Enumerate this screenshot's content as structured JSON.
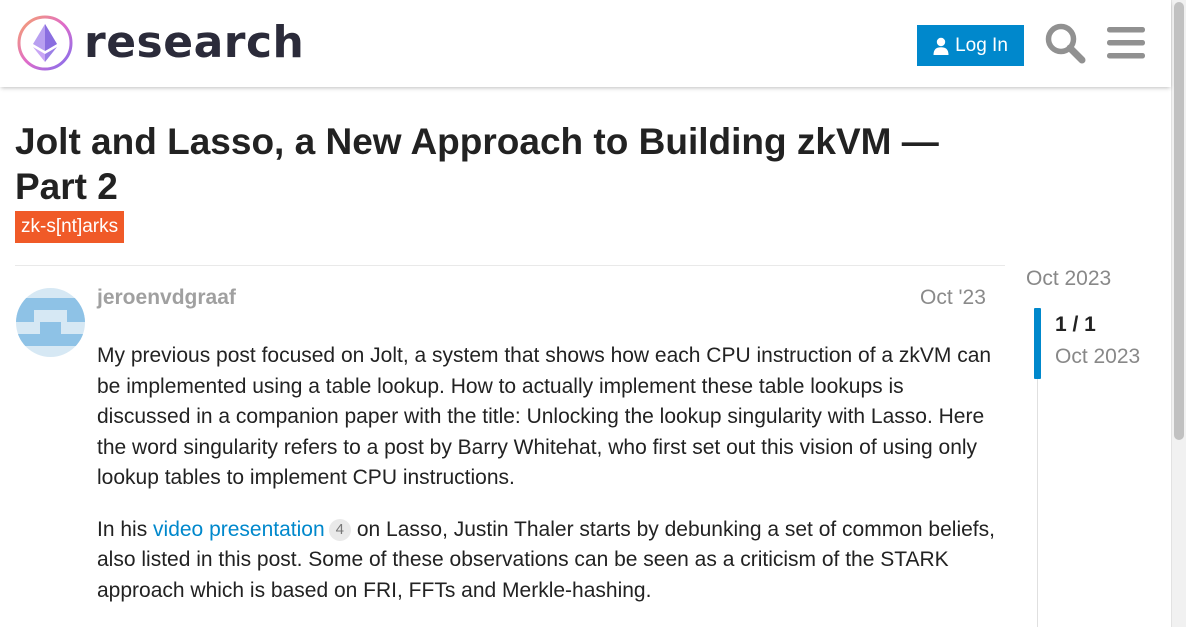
{
  "header": {
    "site_name": "research",
    "login_label": "Log In"
  },
  "topic": {
    "title": "Jolt and Lasso, a New Approach to Building zkVM — Part 2",
    "tag": "zk-s[nt]arks"
  },
  "post": {
    "username": "jeroenvdgraaf",
    "date": "Oct '23",
    "paragraph1": "My previous post focused on Jolt, a system that shows how each CPU instruction of a zkVM can be implemented using a table lookup. How to actually implement these table lookups is discussed in a companion paper with the title: Unlocking the lookup singularity with Lasso. Here the word singularity refers to a post by Barry Whitehat, who first set out this vision of using only lookup tables to implement CPU instructions.",
    "paragraph2_prefix": "In his ",
    "paragraph2_link": "video presentation",
    "paragraph2_link_clicks": "4",
    "paragraph2_suffix": " on Lasso, Justin Thaler starts by debunking a set of common beliefs, also listed in this post. Some of these observations can be seen as a criticism of the STARK approach which is based on FRI, FFTs and Merkle-hashing."
  },
  "timeline": {
    "start_date": "Oct 2023",
    "position": "1 / 1",
    "current_date": "Oct 2023"
  },
  "icons": {
    "login": "user-icon",
    "search": "search-icon",
    "menu": "hamburger-menu-icon",
    "logo": "ethereum-logo-icon"
  },
  "colors": {
    "accent": "#0088cc",
    "tag": "#f05a28"
  }
}
